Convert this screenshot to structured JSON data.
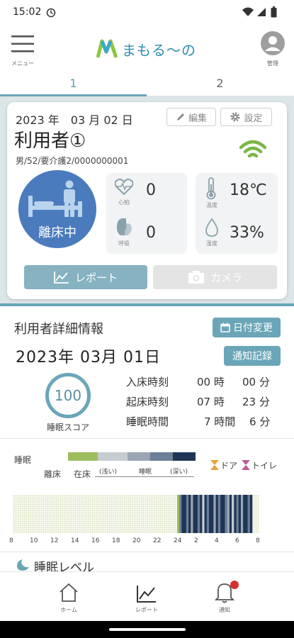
{
  "status_bar": {
    "time": "15:02"
  },
  "header": {
    "menu_label": "メニュー",
    "app_title": "まもる〜の",
    "settings_label": "管理"
  },
  "tabs": [
    {
      "label": "1"
    },
    {
      "label": "2"
    }
  ],
  "resident_card": {
    "date": "2023 年　03 月 02 日",
    "edit_label": "編集",
    "settings_label": "設定",
    "name": "利用者①",
    "details": "男/52/要介護2/0000000001",
    "status_label": "離床中",
    "heart_label": "心拍",
    "heart_value": "0",
    "breath_label": "呼吸",
    "breath_value": "0",
    "temp_label": "温度",
    "temp_value": "18℃",
    "humidity_label": "湿度",
    "humidity_value": "33%",
    "report_button": "レポート",
    "camera_button": "カメラ"
  },
  "detail": {
    "section_title": "利用者詳細情報",
    "change_date_button": "日付変更",
    "date": "2023年 03月 01日",
    "notify_log_button": "通知記録",
    "score_value": "100",
    "score_label": "睡眠スコア",
    "bed_in_label": "入床時刻",
    "bed_in_hour": "00 時",
    "bed_in_min": "00 分",
    "wake_label": "起床時刻",
    "wake_hour": "07 時",
    "wake_min": "23 分",
    "sleep_label": "睡眠時間",
    "sleep_hour": "7 時間",
    "sleep_min": "6 分"
  },
  "sleep_chart": {
    "legend_sleep": "睡眠",
    "legend_out": "離床",
    "legend_in_bed": "在床",
    "legend_shallow": "(浅い)",
    "legend_mid": "睡眠",
    "legend_deep": "(深い)",
    "legend_door": "ドア",
    "legend_toilet": "トイレ",
    "colors": {
      "in_bed": "#9dbd5f",
      "shallow": "#c5cdd3",
      "light": "#9aa6b3",
      "mid": "#6b7f96",
      "deep": "#1f3556"
    },
    "x_ticks": [
      "8",
      "10",
      "12",
      "14",
      "16",
      "18",
      "20",
      "22",
      "24",
      "2",
      "4",
      "6",
      "8"
    ]
  },
  "sleep_level": {
    "label": "睡眠レベル"
  },
  "bottom_nav": [
    {
      "label": "ホーム"
    },
    {
      "label": "レポート"
    },
    {
      "label": "通知"
    }
  ]
}
